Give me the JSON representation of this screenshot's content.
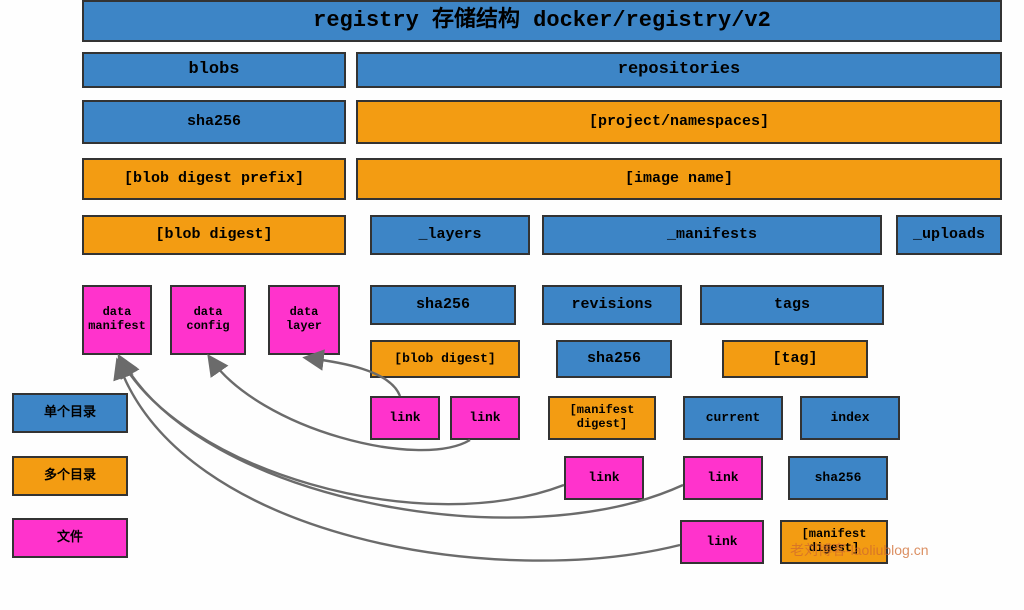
{
  "diagram": {
    "title": "registry 存储结构 docker/registry/v2",
    "watermark": "老刘博客-laoliublog.cn",
    "legend": {
      "single_dir": "单个目录",
      "multi_dir": "多个目录",
      "file": "文件"
    },
    "blobs_branch": {
      "root": "blobs",
      "sha256": "sha256",
      "prefix": "[blob digest prefix]",
      "digest": "[blob digest]",
      "data_manifest": "data\nmanifest",
      "data_config": "data\nconfig",
      "data_layer": "data\nlayer"
    },
    "repos_branch": {
      "root": "repositories",
      "project": "[project/namespaces]",
      "image_name": "[image name]",
      "layers": "_layers",
      "manifests": "_manifests",
      "uploads": "_uploads",
      "layers_sha256": "sha256",
      "layers_blob_digest": "[blob digest]",
      "layers_link1": "link",
      "layers_link2": "link",
      "manifests_revisions": "revisions",
      "manifests_tags": "tags",
      "revisions_sha256": "sha256",
      "tags_tag": "[tag]",
      "manifest_digest": "[manifest\ndigest]",
      "revisions_link": "link",
      "tag_current": "current",
      "tag_index": "index",
      "current_link": "link",
      "index_sha256": "sha256",
      "index_link": "link",
      "index_manifest_digest": "[manifest\ndigest]"
    }
  }
}
